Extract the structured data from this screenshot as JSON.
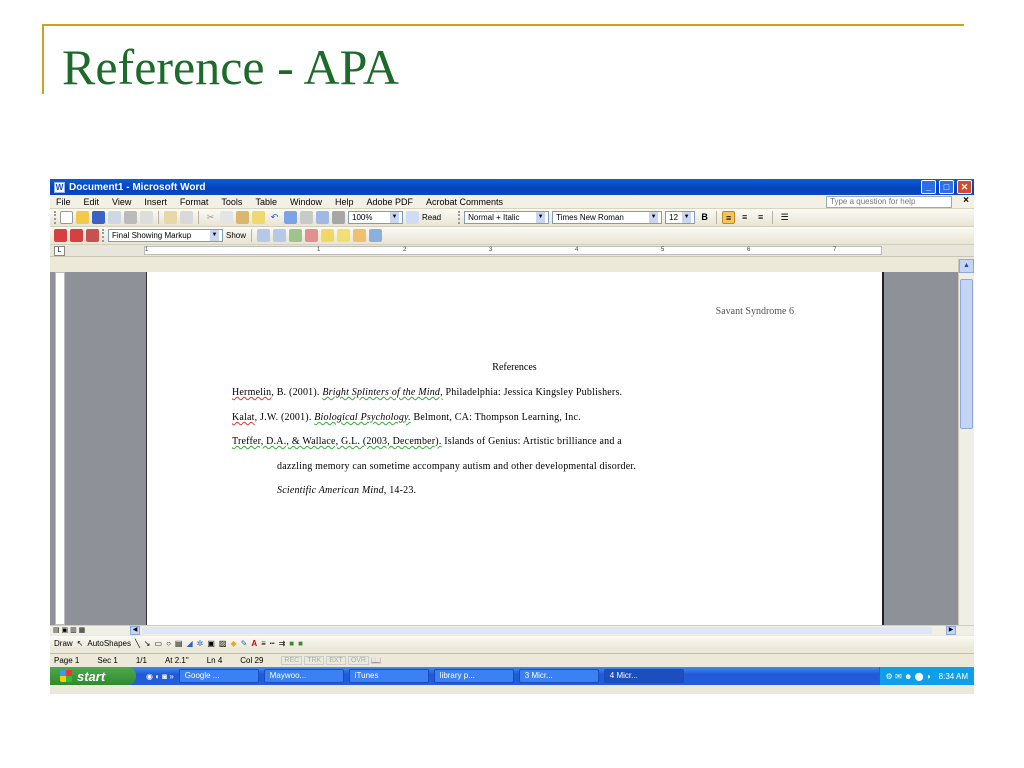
{
  "slide": {
    "title": "Reference - APA"
  },
  "window": {
    "title": "Document1 - Microsoft Word",
    "controls": {
      "minimize": "_",
      "maximize": "□",
      "close": "✕"
    }
  },
  "menu": {
    "items": [
      "File",
      "Edit",
      "View",
      "Insert",
      "Format",
      "Tools",
      "Table",
      "Window",
      "Help",
      "Adobe PDF",
      "Acrobat Comments"
    ],
    "help_placeholder": "Type a question for help",
    "close": "×"
  },
  "toolbar_standard": {
    "zoom": "100%",
    "read": "Read"
  },
  "toolbar_formatting": {
    "style": "Normal + Italic",
    "font": "Times New Roman",
    "size": "12",
    "bold": "B"
  },
  "toolbar_review": {
    "markup": "Final Showing Markup",
    "show": "Show"
  },
  "ruler": {
    "labels": [
      "1",
      "1",
      "2",
      "3",
      "4",
      "5",
      "6",
      "7"
    ]
  },
  "document": {
    "header": "Savant Syndrome 6",
    "heading": "References",
    "refs": {
      "r1_author": "Hermelin",
      "r1_rest": ", B. (2001). ",
      "r1_title": "Bright Splinters of the Mind,",
      "r1_pub": " Philadelphia: Jessica Kingsley Publishers.",
      "r2_author": "Kalat",
      "r2_rest": ", J.W. (2001). ",
      "r2_title": "Biological Psychology.",
      "r2_pub": " Belmont, CA: Thompson Learning, Inc.",
      "r3_authors": "Treffer, D.A., & Wallace, G.L. (2003, December).",
      "r3_rest": " Islands of Genius: Artistic brilliance and a",
      "r3_line2": "dazzling memory can sometime accompany autism and other developmental disorder.",
      "r3_journal": "Scientific American Mind,",
      "r3_pages": " 14-23."
    }
  },
  "drawbar": {
    "draw": "Draw",
    "autoshapes": "AutoShapes"
  },
  "status": {
    "page": "Page 1",
    "sec": "Sec 1",
    "pages": "1/1",
    "at": "At 2.1\"",
    "ln": "Ln 4",
    "col": "Col 29",
    "modes": [
      "REC",
      "TRK",
      "EXT",
      "OVR"
    ]
  },
  "taskbar": {
    "start": "start",
    "buttons": [
      "Google ...",
      "Maywoo...",
      "iTunes",
      "library p...",
      "3 Micr...",
      "4 Micr..."
    ],
    "clock": "8:34 AM"
  }
}
